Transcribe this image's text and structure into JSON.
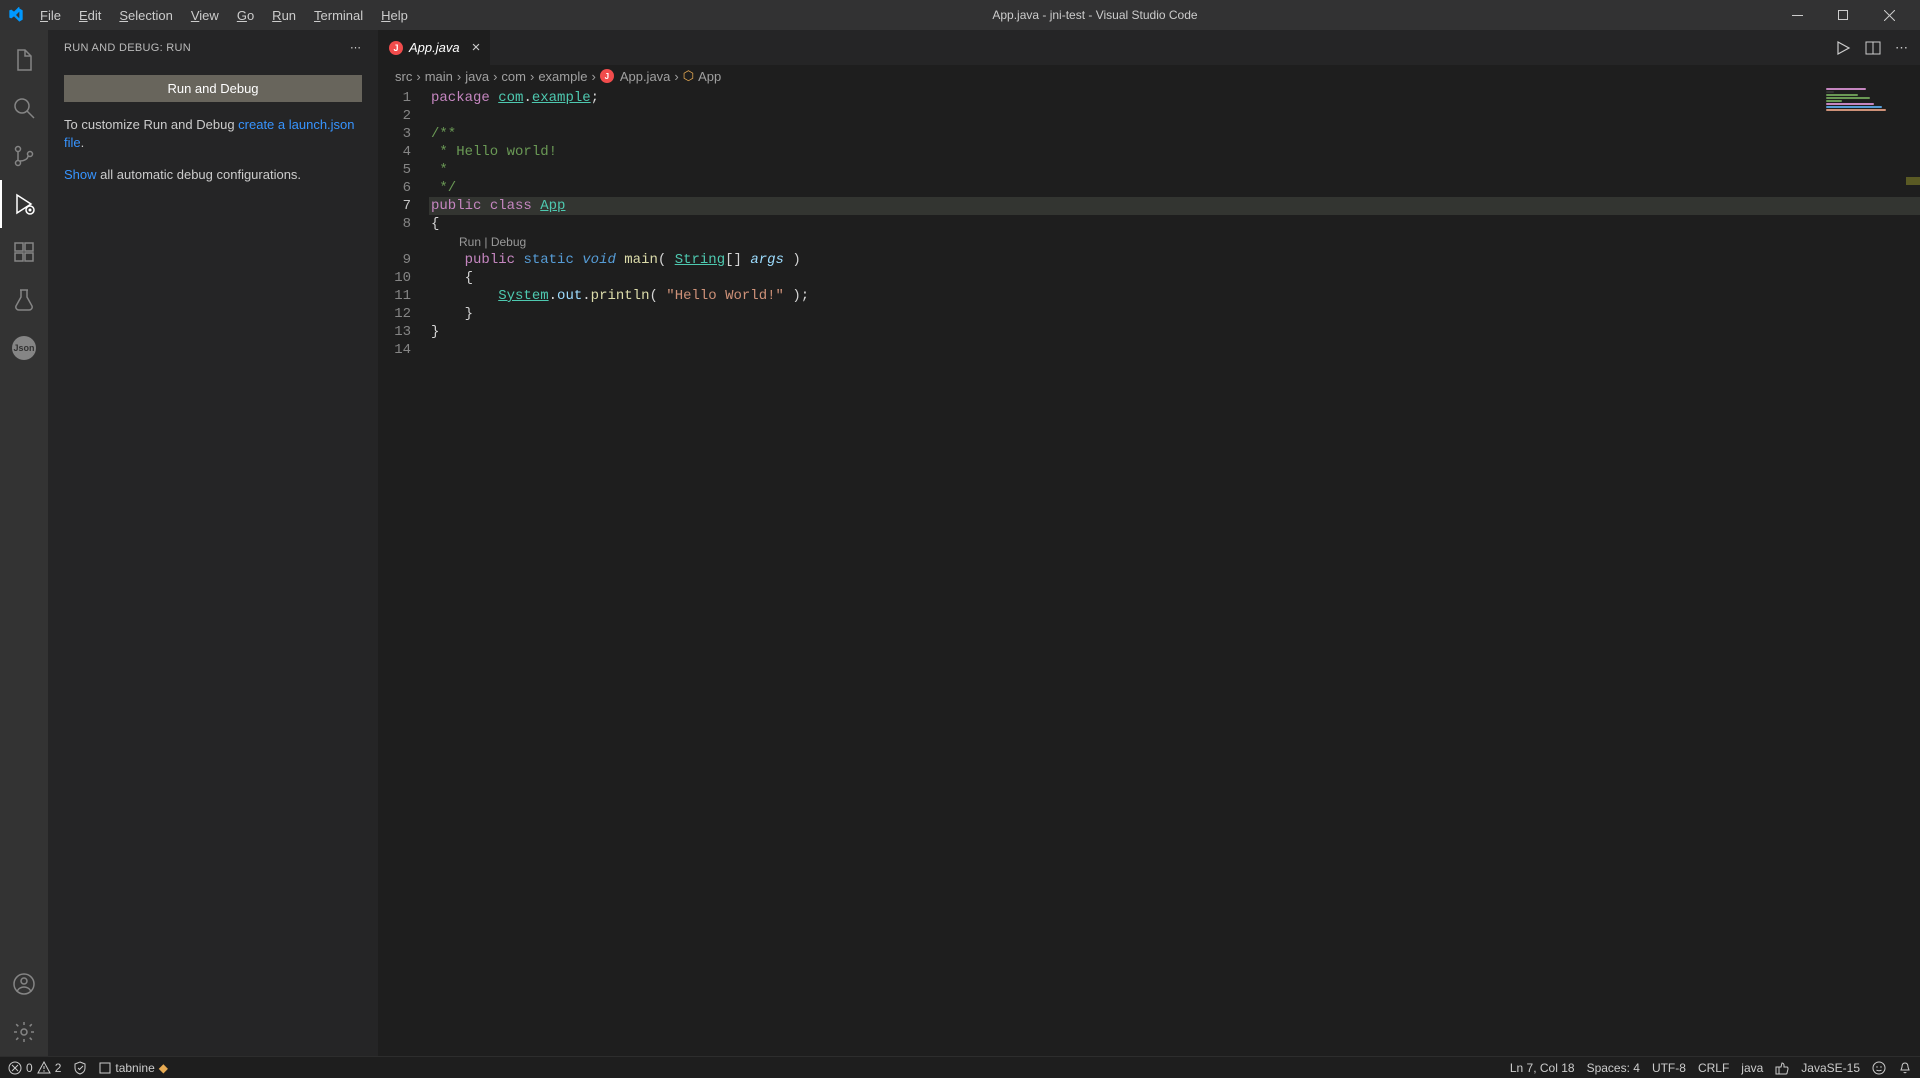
{
  "titlebar": {
    "title": "App.java - jni-test - Visual Studio Code",
    "menus": [
      "File",
      "Edit",
      "Selection",
      "View",
      "Go",
      "Run",
      "Terminal",
      "Help"
    ]
  },
  "activity": {
    "json_label": "Json"
  },
  "sidepanel": {
    "header": "RUN AND DEBUG: RUN",
    "run_button": "Run and Debug",
    "customize_pre": "To customize Run and Debug ",
    "customize_link": "create a launch.json file",
    "customize_post": ".",
    "show_link": "Show",
    "show_tail": " all automatic debug configurations."
  },
  "tab": {
    "name": "App.java"
  },
  "breadcrumb": [
    "src",
    "main",
    "java",
    "com",
    "example",
    "App.java",
    "App"
  ],
  "codelens": {
    "run": "Run",
    "debug": "Debug"
  },
  "code": {
    "l1_kw": "package",
    "l1_p1": "com",
    "l1_p2": "example",
    "l3": "/**",
    "l4": " * Hello world!",
    "l5": " *",
    "l6": " */",
    "l7_public": "public",
    "l7_class": "class",
    "l7_name": "App",
    "l8": "{",
    "l9_public": "public",
    "l9_static": "static",
    "l9_void": "void",
    "l9_main": "main",
    "l9_string": "String",
    "l9_br": "[]",
    "l9_args": "args",
    "l10": "{",
    "l11_sys": "System",
    "l11_out": "out",
    "l11_println": "println",
    "l11_str": "\"Hello World!\"",
    "l12": "}",
    "l13": "}"
  },
  "status": {
    "errors": "0",
    "warnings": "2",
    "tabnine": "tabnine",
    "pos": "Ln 7, Col 18",
    "spaces": "Spaces: 4",
    "enc": "UTF-8",
    "eol": "CRLF",
    "lang": "java",
    "jdk": "JavaSE-15"
  }
}
